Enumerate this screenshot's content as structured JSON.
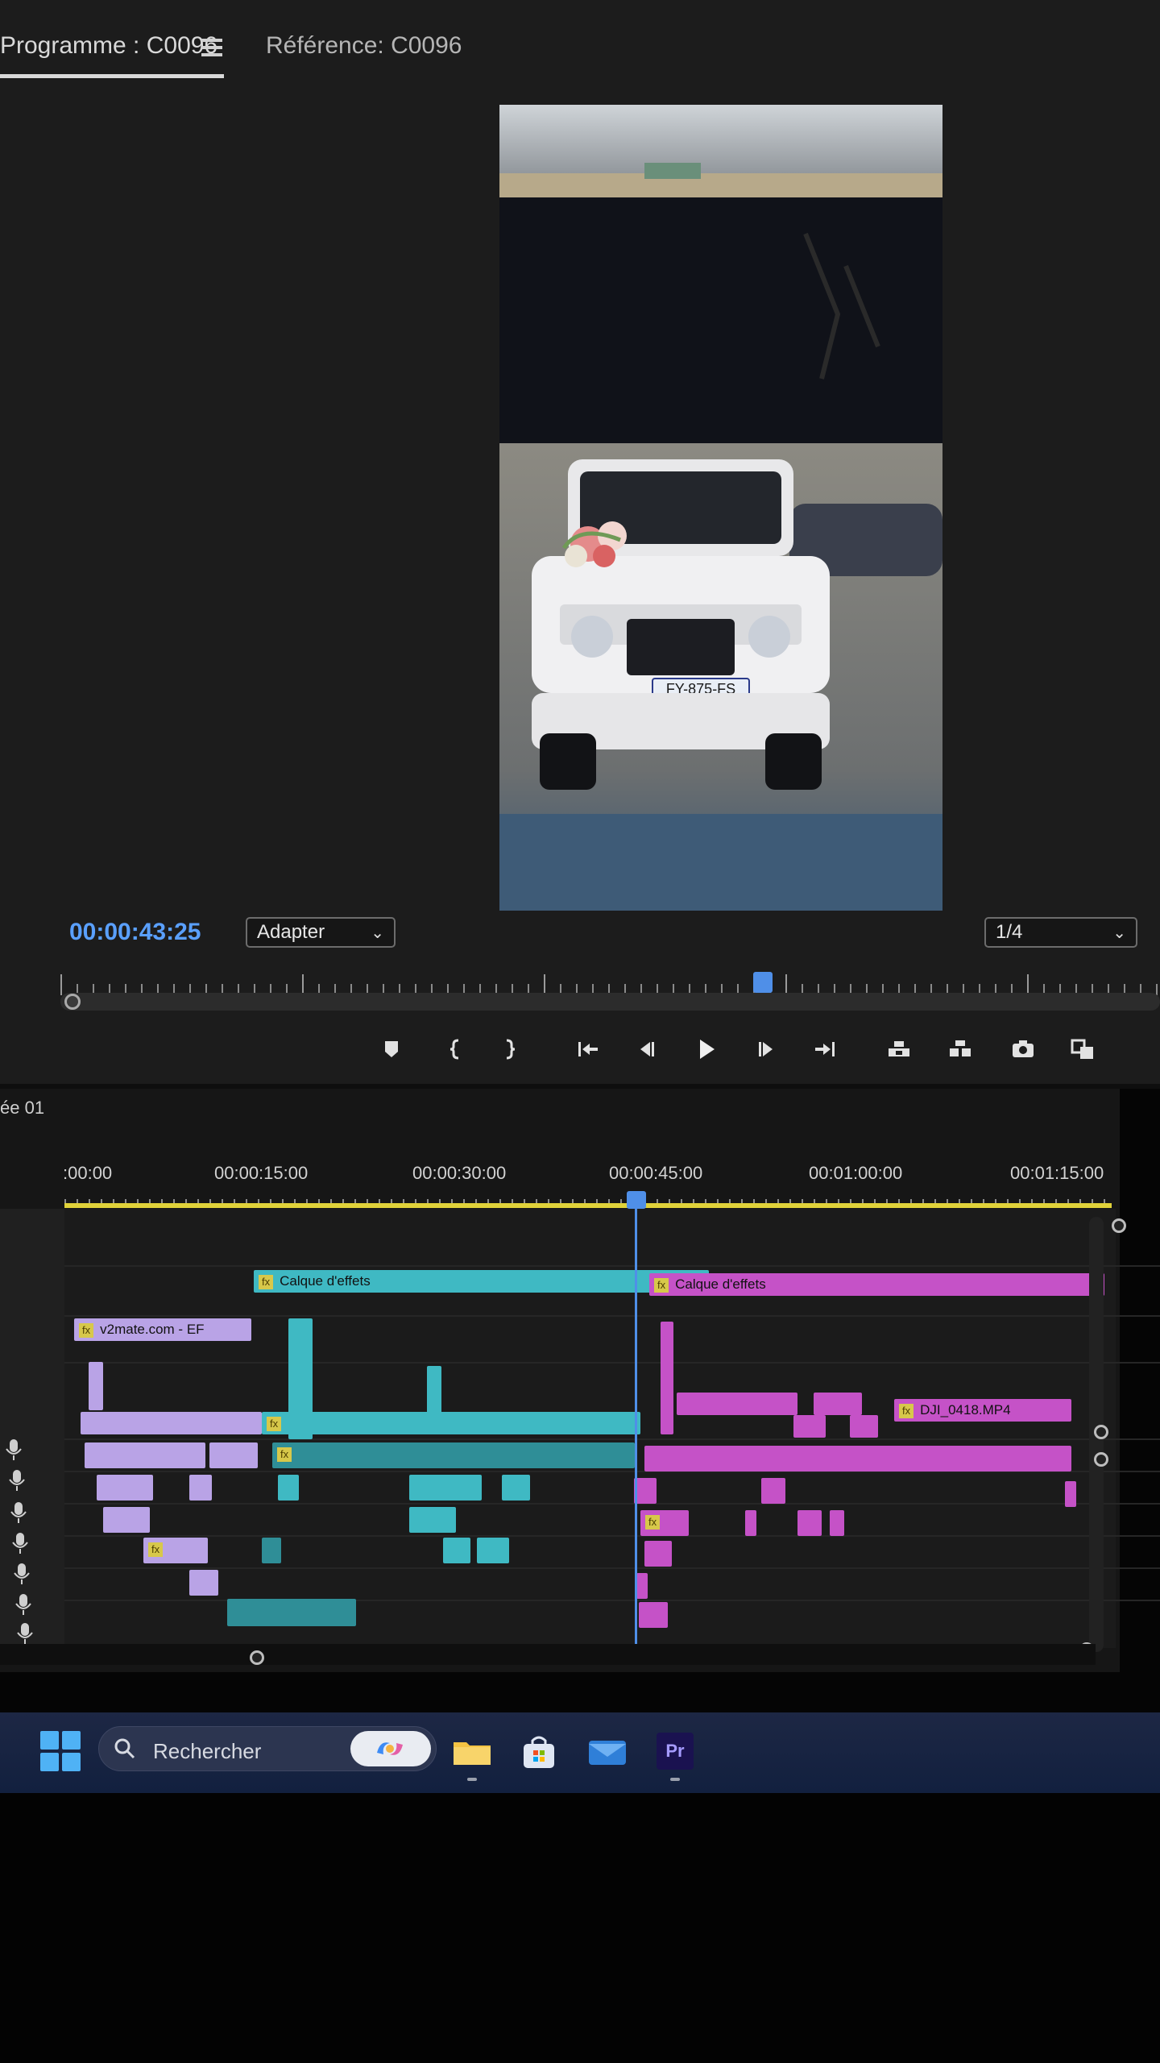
{
  "monitor": {
    "tab_program": "Programme : C0096",
    "tab_reference": "Référence: C0096",
    "timecode": "00:00:43:25",
    "fit": "Adapter",
    "resolution": "1/4",
    "controls": [
      "marker-icon",
      "in-point-icon",
      "out-point-icon",
      "go-to-in-icon",
      "step-back-icon",
      "play-icon",
      "step-forward-icon",
      "go-to-out-icon",
      "lift-icon",
      "extract-icon",
      "camera-icon",
      "compare-icon"
    ]
  },
  "timeline": {
    "sequence": "ée 01",
    "ruler": [
      ":00:00",
      "00:00:15:00",
      "00:00:30:00",
      "00:00:45:00",
      "00:01:00:00",
      "00:01:15:00"
    ],
    "clips": {
      "adjustment_left": "Calque d'effets",
      "adjustment_right": "Calque d'effets",
      "v2mate": "v2mate.com - EF",
      "dji": "DJI_0418.MP4",
      "fx": "fx"
    }
  },
  "video": {
    "plate": "FY-875-FS"
  },
  "taskbar": {
    "search_placeholder": "Rechercher",
    "premiere_label": "Pr"
  },
  "colors": {
    "accent": "#4f8fe8",
    "cyan_clip": "#3fb9c3",
    "magenta_clip": "#c552c7",
    "violet_clip": "#b9a3e6",
    "work_area": "#e0d23a"
  }
}
